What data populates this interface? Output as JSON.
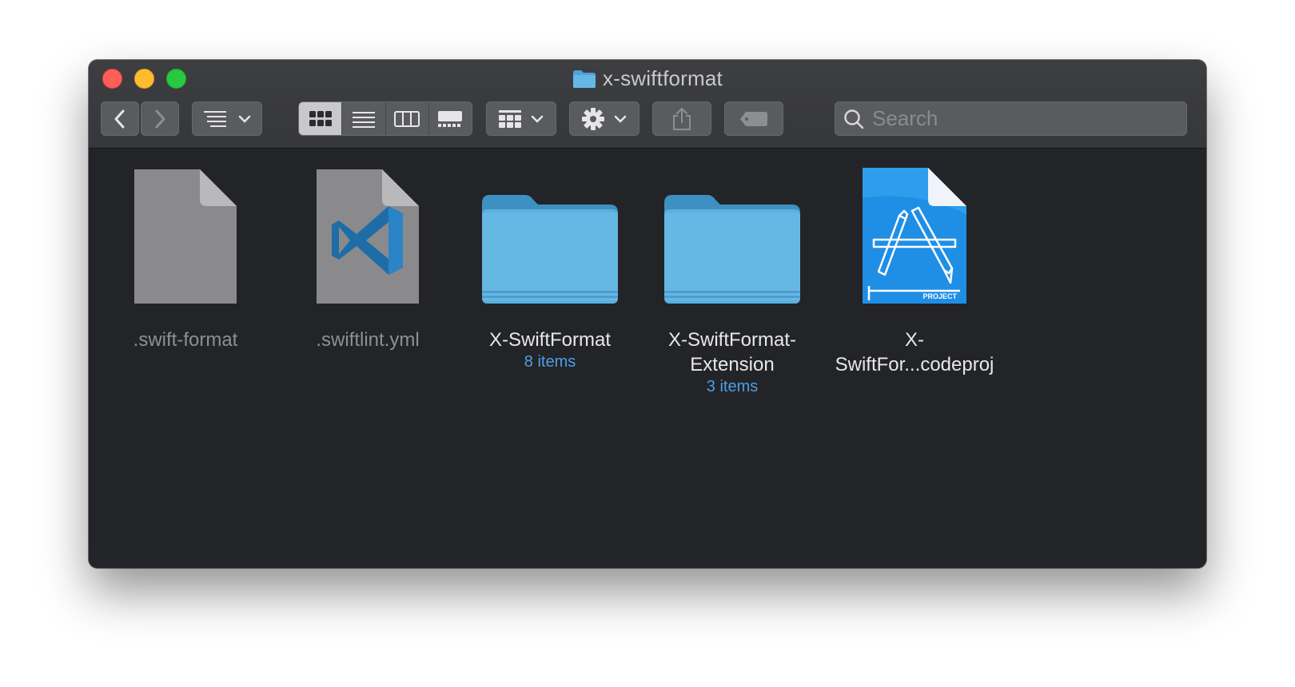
{
  "window": {
    "title": "x-swiftformat",
    "title_icon": "folder-icon"
  },
  "toolbar": {
    "back": "chevron-left-icon",
    "forward": "chevron-right-icon",
    "group_by": "list-sort-icon",
    "view_modes": [
      "icon-view",
      "list-view",
      "column-view",
      "gallery-view"
    ],
    "active_view": "icon-view",
    "arrange": "grid-icon",
    "action": "gear-icon",
    "share": "share-icon",
    "tags": "tag-icon",
    "search": {
      "placeholder": "Search",
      "value": ""
    }
  },
  "items": [
    {
      "name": ".swift-format",
      "kind": "file",
      "dimmed": true
    },
    {
      "name": ".swiftlint.yml",
      "kind": "vscode-file",
      "dimmed": true
    },
    {
      "name": "X-SwiftFormat",
      "kind": "folder",
      "count": "8 items"
    },
    {
      "name_line1": "X-SwiftFormat-",
      "name_line2": "Extension",
      "kind": "folder",
      "count": "3 items"
    },
    {
      "name_line1": "X-",
      "name_line2": "SwiftFor...codeproj",
      "kind": "xcodeproj",
      "badge": "PROJECT"
    }
  ],
  "colors": {
    "window_bg": "#232427",
    "folder": "#5ab0df",
    "accent": "#4c9fe8",
    "project_blue": "#1f8fe6"
  }
}
